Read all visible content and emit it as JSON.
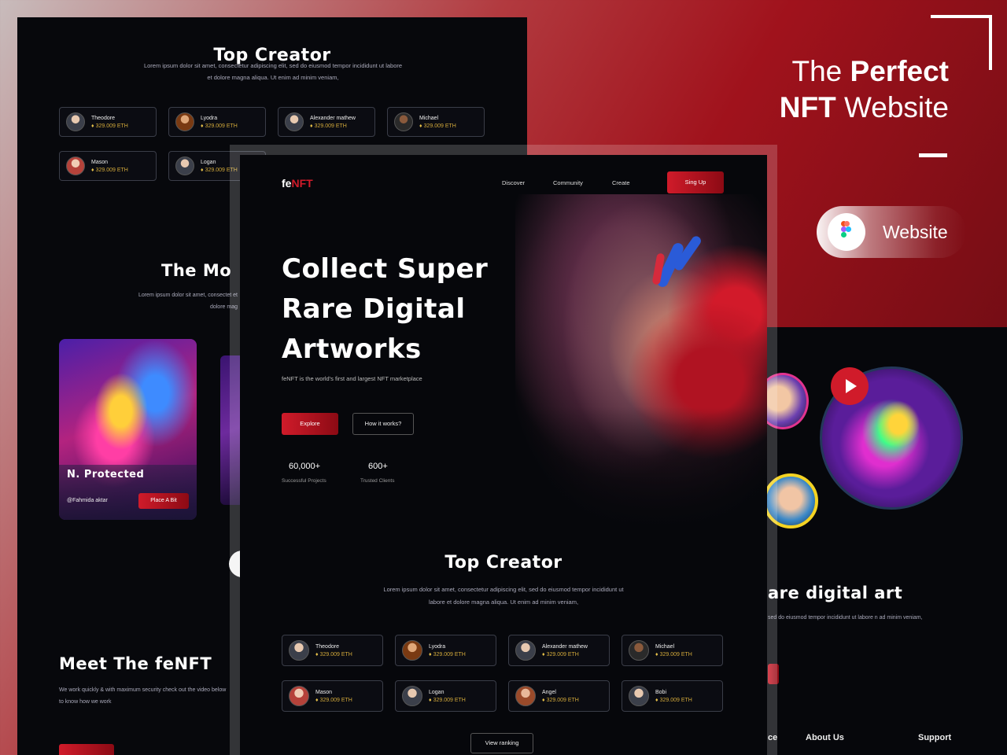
{
  "brand": {
    "headline_line1_normal": "The ",
    "headline_line1_bold": "Perfect",
    "headline_line2_bold": "NFT",
    "headline_line2_normal": " Website",
    "pill_label": "Website",
    "pill_icon": "figma-icon"
  },
  "back_left": {
    "title": "Top Creator",
    "desc": "Lorem ipsum dolor sit amet, consectetur adipiscing elit, sed do eiusmod tempor incididunt ut labore et dolore magna aliqua. Ut enim ad minim veniam,",
    "creators": [
      {
        "name": "Theodore",
        "value": "329.009 ETH"
      },
      {
        "name": "Lyodra",
        "value": "329.009 ETH"
      },
      {
        "name": "Alexander mathew",
        "value": "329.009 ETH"
      },
      {
        "name": "Michael",
        "value": "329.009 ETH"
      },
      {
        "name": "Mason",
        "value": "329.009 ETH"
      },
      {
        "name": "Logan",
        "value": "329.009 ETH"
      }
    ],
    "most_title": "The Mo",
    "most_desc": "Lorem ipsum dolor sit amet, consectet et dolore mag",
    "nft_title": "N. Protected",
    "nft_user": "@Fahmida aktar",
    "nft_button": "Place A Bit",
    "meet_title": "Meet The feNFT",
    "meet_desc": "We work quickly & with maximum security check out the video below to know how we work"
  },
  "back_right": {
    "heading": "are digital art",
    "desc": "sed do eiusmod tempor incididunt ut labore n ad minim veniam,",
    "footer": [
      "ce",
      "About Us",
      "Support"
    ]
  },
  "front": {
    "logo_prefix": "fe",
    "logo_accent": "NFT",
    "nav": [
      "Discover",
      "Community",
      "Create"
    ],
    "signup": "Sing Up",
    "hero_title": [
      "Collect Super",
      "Rare Digital",
      "Artworks"
    ],
    "hero_sub": "feNFT is the world's first and largest NFT marketplace",
    "explore": "Explore",
    "how_it_works": "How it works?",
    "stats": [
      {
        "value": "60,000+",
        "label": "Successful Projects"
      },
      {
        "value": "600+",
        "label": "Trusted Clients"
      }
    ],
    "top_creator_title": "Top Creator",
    "top_creator_desc": "Lorem ipsum dolor sit amet, consectetur adipiscing elit, sed do eiusmod tempor incididunt ut labore et dolore magna aliqua. Ut enim ad minim veniam,",
    "creators": [
      {
        "name": "Theodore",
        "value": "329.009 ETH"
      },
      {
        "name": "Lyodra",
        "value": "329.009 ETH"
      },
      {
        "name": "Alexander mathew",
        "value": "329.009 ETH"
      },
      {
        "name": "Michael",
        "value": "329.009 ETH"
      },
      {
        "name": "Mason",
        "value": "329.009 ETH"
      },
      {
        "name": "Logan",
        "value": "329.009 ETH"
      },
      {
        "name": "Angel",
        "value": "329.009 ETH"
      },
      {
        "name": "Bobi",
        "value": "329.009 ETH"
      }
    ],
    "view_ranking": "View ranking"
  },
  "colors": {
    "accent": "#d01b2a",
    "eth": "#e7c14a",
    "bg": "#06070b"
  }
}
